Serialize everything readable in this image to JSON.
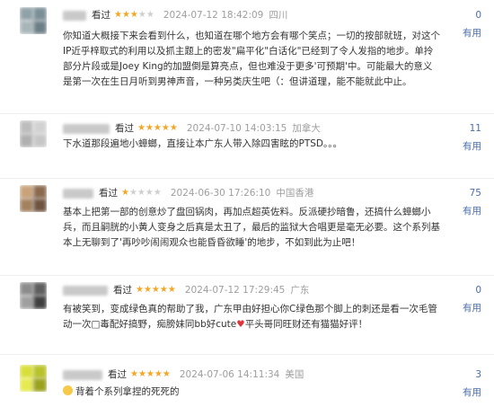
{
  "comments": [
    {
      "watched": "看过",
      "rating": 3,
      "time": "2024-07-12 18:42:09",
      "location": "四川",
      "votes": "0",
      "vote_label": "有用",
      "content": "你知道大概接下来会看到什么，也知道在哪个地方会有哪个笑点；一切的按部就班，对这个IP近乎梓取式的利用以及抓主题上的密发\"扁平化\"白话化\"已经到了令人发指的地步。单拎部分片段或是Joey King的加盟倒是算亮点，但也难没于更多'可预期'中。可能最大的意义是第一次在生日月听到男神声音，一种另类庆生吧（：但讲道理，能不能就此中止。"
    },
    {
      "watched": "看过",
      "rating": 5,
      "time": "2024-07-10 14:03:15",
      "location": "加拿大",
      "votes": "11",
      "vote_label": "有用",
      "content": "下水道那段遍地小蟑螂，直接让本广东人带入除四害眩的PTSD。。。"
    },
    {
      "watched": "看过",
      "rating": 1,
      "time": "2024-06-30 17:26:10",
      "location": "中国香港",
      "votes": "75",
      "vote_label": "有用",
      "content": "基本上把第一部的创意炒了盘回锅肉，再加点超英佐料。反派硬抄暗鲁，还搞什么蟑螂小兵，而且嗣胱的小黄人变身之后真是太丑了，最后的监狱大合唱更是毫无必要。这个系列基本上无聊到了'再吵吵闹闹观众也能昏昏欲睡'的地步，不如到此为止吧！"
    },
    {
      "watched": "看过",
      "rating": 5,
      "time": "2024-07-12 17:29:45",
      "location": "广东",
      "votes": "0",
      "vote_label": "有用",
      "content": "有被笑到，变成绿色真的帮助了我，广东甲由好担心你C绿色那个脚上的刺还是看一次毛管动一次□毒配好搞野，痴膀妹同bb好cute",
      "content_after_heart": "平头哥同旺财还有猫猫好评！",
      "heart": "♥"
    },
    {
      "watched": "看过",
      "rating": 5,
      "time": "2024-07-06 14:11:34",
      "location": "美国",
      "votes": "3",
      "vote_label": "有用",
      "content": "背着个系列拿捏的死死的",
      "emoji": "smile-emoji"
    }
  ],
  "colors": {
    "star_on": "#f5a623",
    "star_off": "#cfcfcf",
    "link": "#4a6ea9",
    "meta": "#9e9e9e"
  }
}
